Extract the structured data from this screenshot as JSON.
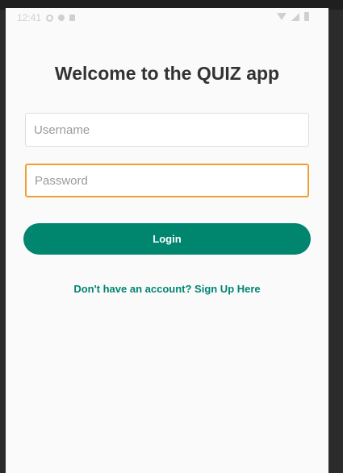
{
  "status_bar": {
    "time": "12:41",
    "left_icons": [
      "clock-icon",
      "settings-icon",
      "notification-icon"
    ],
    "right_icons": [
      "wifi-icon",
      "signal-icon",
      "battery-icon"
    ]
  },
  "login_screen": {
    "title": "Welcome to the QUIZ app",
    "username_placeholder": "Username",
    "username_value": "",
    "password_placeholder": "Password",
    "password_value": "",
    "login_label": "Login",
    "signup_label": "Don't have an account? Sign Up Here"
  },
  "colors": {
    "accent": "#00856f",
    "focus_border": "#f0a030",
    "background": "#fafafa",
    "title": "#333333"
  }
}
